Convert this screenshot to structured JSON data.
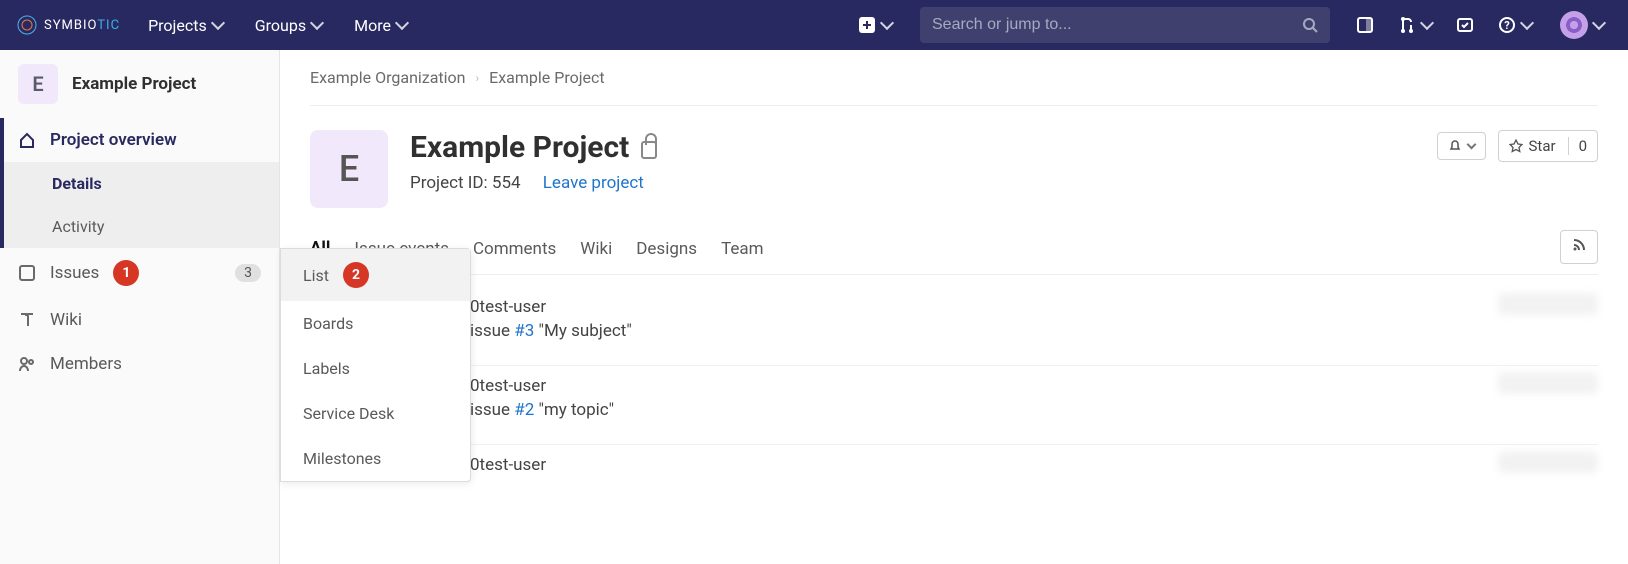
{
  "topnav": {
    "brand": {
      "symbio": "SYMBIO",
      "tic": "TIC"
    },
    "projects": "Projects",
    "groups": "Groups",
    "more": "More",
    "search_placeholder": "Search or jump to..."
  },
  "sidebar": {
    "project_letter": "E",
    "project_name": "Example Project",
    "overview": "Project overview",
    "details": "Details",
    "activity": "Activity",
    "issues": "Issues",
    "issues_count": "3",
    "wiki": "Wiki",
    "members": "Members"
  },
  "markers": {
    "m1": "1",
    "m2": "2"
  },
  "flyout": {
    "list": "List",
    "boards": "Boards",
    "labels": "Labels",
    "service_desk": "Service Desk",
    "milestones": "Milestones"
  },
  "breadcrumb": {
    "org": "Example Organization",
    "proj": "Example Project"
  },
  "header": {
    "letter": "E",
    "title": "Example Project",
    "project_id": "Project ID: 554",
    "leave": "Leave project",
    "star": "Star",
    "star_count": "0"
  },
  "tabs": {
    "all": "All",
    "issue_events": "Issue events",
    "comments": "Comments",
    "wiki": "Wiki",
    "designs": "Designs",
    "team": "Team"
  },
  "activity": [
    {
      "user": "0test-user",
      "action": "issue",
      "ref": "#3",
      "title": "\"My subject\""
    },
    {
      "user": "0test-user",
      "action": "issue",
      "ref": "#2",
      "title": "\"my topic\""
    },
    {
      "user": "0test-user",
      "action": "",
      "ref": "",
      "title": ""
    }
  ]
}
